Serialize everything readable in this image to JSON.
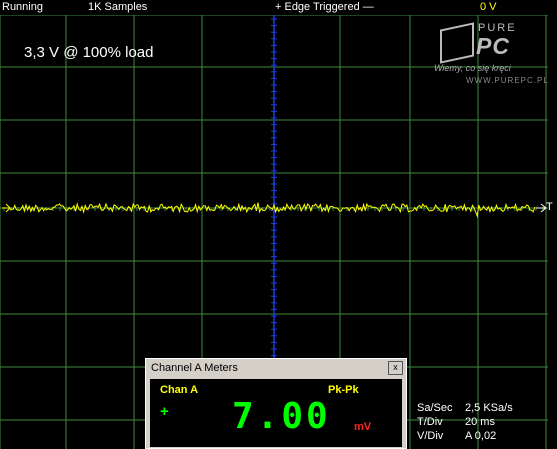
{
  "status_bar": {
    "state": "Running",
    "samples": "1K Samples",
    "trigger": "+ Edge Triggered  —",
    "trigger_level": "0 V"
  },
  "overlay_label": "3,3 V @ 100% load",
  "logo": {
    "brand_top": "PURE",
    "brand_bottom": "PC",
    "tagline": "Wiemy, co się kręci",
    "url": "WWW.PUREPC.PL"
  },
  "trigger_marker": "T",
  "meters": {
    "title": "Channel A Meters",
    "close": "x",
    "channel": "Chan A",
    "measurement": "Pk-Pk",
    "reading": "7.00",
    "unit": "mV",
    "sign": "+"
  },
  "readouts": [
    {
      "label": "Sa/Sec",
      "value": "2,5 KSa/s"
    },
    {
      "label": "T/Div",
      "value": "20 ms"
    },
    {
      "label": "V/Div",
      "value": "A 0,02"
    }
  ],
  "colors": {
    "grid": "#3c8a3c",
    "trace": "#ffff00",
    "center_axis": "#1a3fe0",
    "background": "#000000"
  }
}
